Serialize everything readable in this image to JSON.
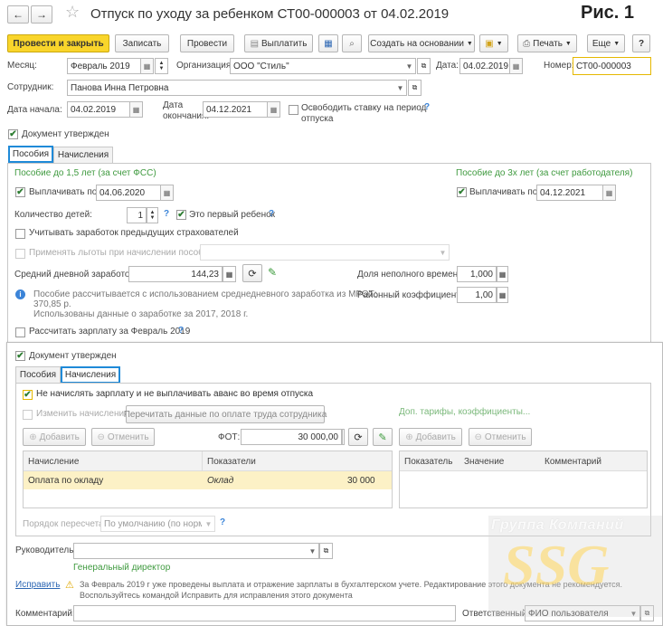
{
  "header": {
    "title": "Отпуск по уходу за ребенком СТ00-000003 от 04.02.2019",
    "fig_label": "Рис. 1"
  },
  "toolbar": {
    "post_close": "Провести и закрыть",
    "write": "Записать",
    "post": "Провести",
    "pay": "Выплатить",
    "create_based": "Создать на основании",
    "print": "Печать",
    "more": "Еще",
    "help": "?"
  },
  "fields": {
    "month_label": "Месяц:",
    "month_value": "Февраль 2019",
    "org_label": "Организация:",
    "org_value": "ООО \"Стиль\"",
    "date_label": "Дата:",
    "date_value": "04.02.2019",
    "number_label": "Номер:",
    "number_value": "СТ00-000003",
    "employee_label": "Сотрудник:",
    "employee_value": "Панова Инна Петровна",
    "start_label": "Дата начала:",
    "start_value": "04.02.2019",
    "end_label_1": "Дата",
    "end_label_2": "окончания:",
    "end_value": "04.12.2021",
    "release_rate_1": "Освободить ставку на период",
    "release_rate_2": "отпуска",
    "doc_approved": "Документ утвержден"
  },
  "tabs1": {
    "benefits": "Пособия",
    "accruals": "Начисления"
  },
  "benefits": {
    "fss_title": "Пособие до 1,5 лет (за счет ФСС)",
    "employer_title": "Пособие до 3х лет (за счет работодателя)",
    "pay_until": "Выплачивать по",
    "pay_until_value": "04.06.2020",
    "pay_until_value2": "04.12.2021",
    "children_label": "Количество детей:",
    "children_value": "1",
    "first_child": "Это первый ребенок",
    "prev_insurers": "Учитывать заработок предыдущих страхователей",
    "apply_benefits": "Применять льготы при начислении пособия",
    "avg_daily_label": "Средний дневной заработок:",
    "avg_daily_value": "144,23",
    "part_time_label": "Доля неполного времени:",
    "part_time_value": "1,000",
    "regional_label": "Районный коэффициент:",
    "regional_value": "1,00",
    "info_1": "Пособие рассчитывается с использованием среднедневного заработка из МРОТ:",
    "info_2": "370,85 р.",
    "info_3": "Использованы данные о заработке за  2017,  2018 г.",
    "calc_salary": "Рассчитать зарплату за Февраль 2019"
  },
  "second": {
    "doc_approved": "Документ утвержден",
    "tab_benefits": "Пособия",
    "tab_accruals": "Начисления",
    "no_salary": "Не начислять зарплату и не выплачивать аванс во время отпуска",
    "change_accruals": "Изменить начисления",
    "refill_btn": "Перечитать данные по оплате труда сотрудника",
    "extra_link": "Доп. тарифы, коэффициенты...",
    "add": "Добавить",
    "cancel": "Отменить",
    "fot_label": "ФОТ:",
    "fot_value": "30 000,00",
    "left_table": {
      "headers": [
        "Начисление",
        "Показатели"
      ],
      "rows": [
        {
          "accrual": "Оплата по окладу",
          "indicator": "Оклад",
          "value": "30 000"
        }
      ]
    },
    "right_table": {
      "headers": [
        "Показатель",
        "Значение",
        "Комментарий"
      ]
    },
    "recalc_label": "Порядок пересчета:",
    "recalc_value": "По умолчанию (по норме"
  },
  "footer": {
    "manager_label": "Руководитель:",
    "director_link": "Генеральный директор",
    "fix_link": "Исправить",
    "warning_1": "За Февраль 2019 г уже проведены выплата и отражение зарплаты в бухгалтерском учете. Редактирование этого документа не рекомендуется.",
    "warning_2": "Воспользуйтесь командой Исправить для исправления этого документа",
    "comment_label": "Комментарий:",
    "responsible_label": "Ответственный:",
    "responsible_value": "ФИО пользователя"
  },
  "watermark": {
    "line1": "Группа Компаний",
    "line2": "SSG"
  },
  "colors": {
    "primary_button": "#f9d52b",
    "tab_highlight": "#1f8ad8",
    "green_text": "#3f9a3f",
    "selected_row": "#fcf1c6"
  }
}
